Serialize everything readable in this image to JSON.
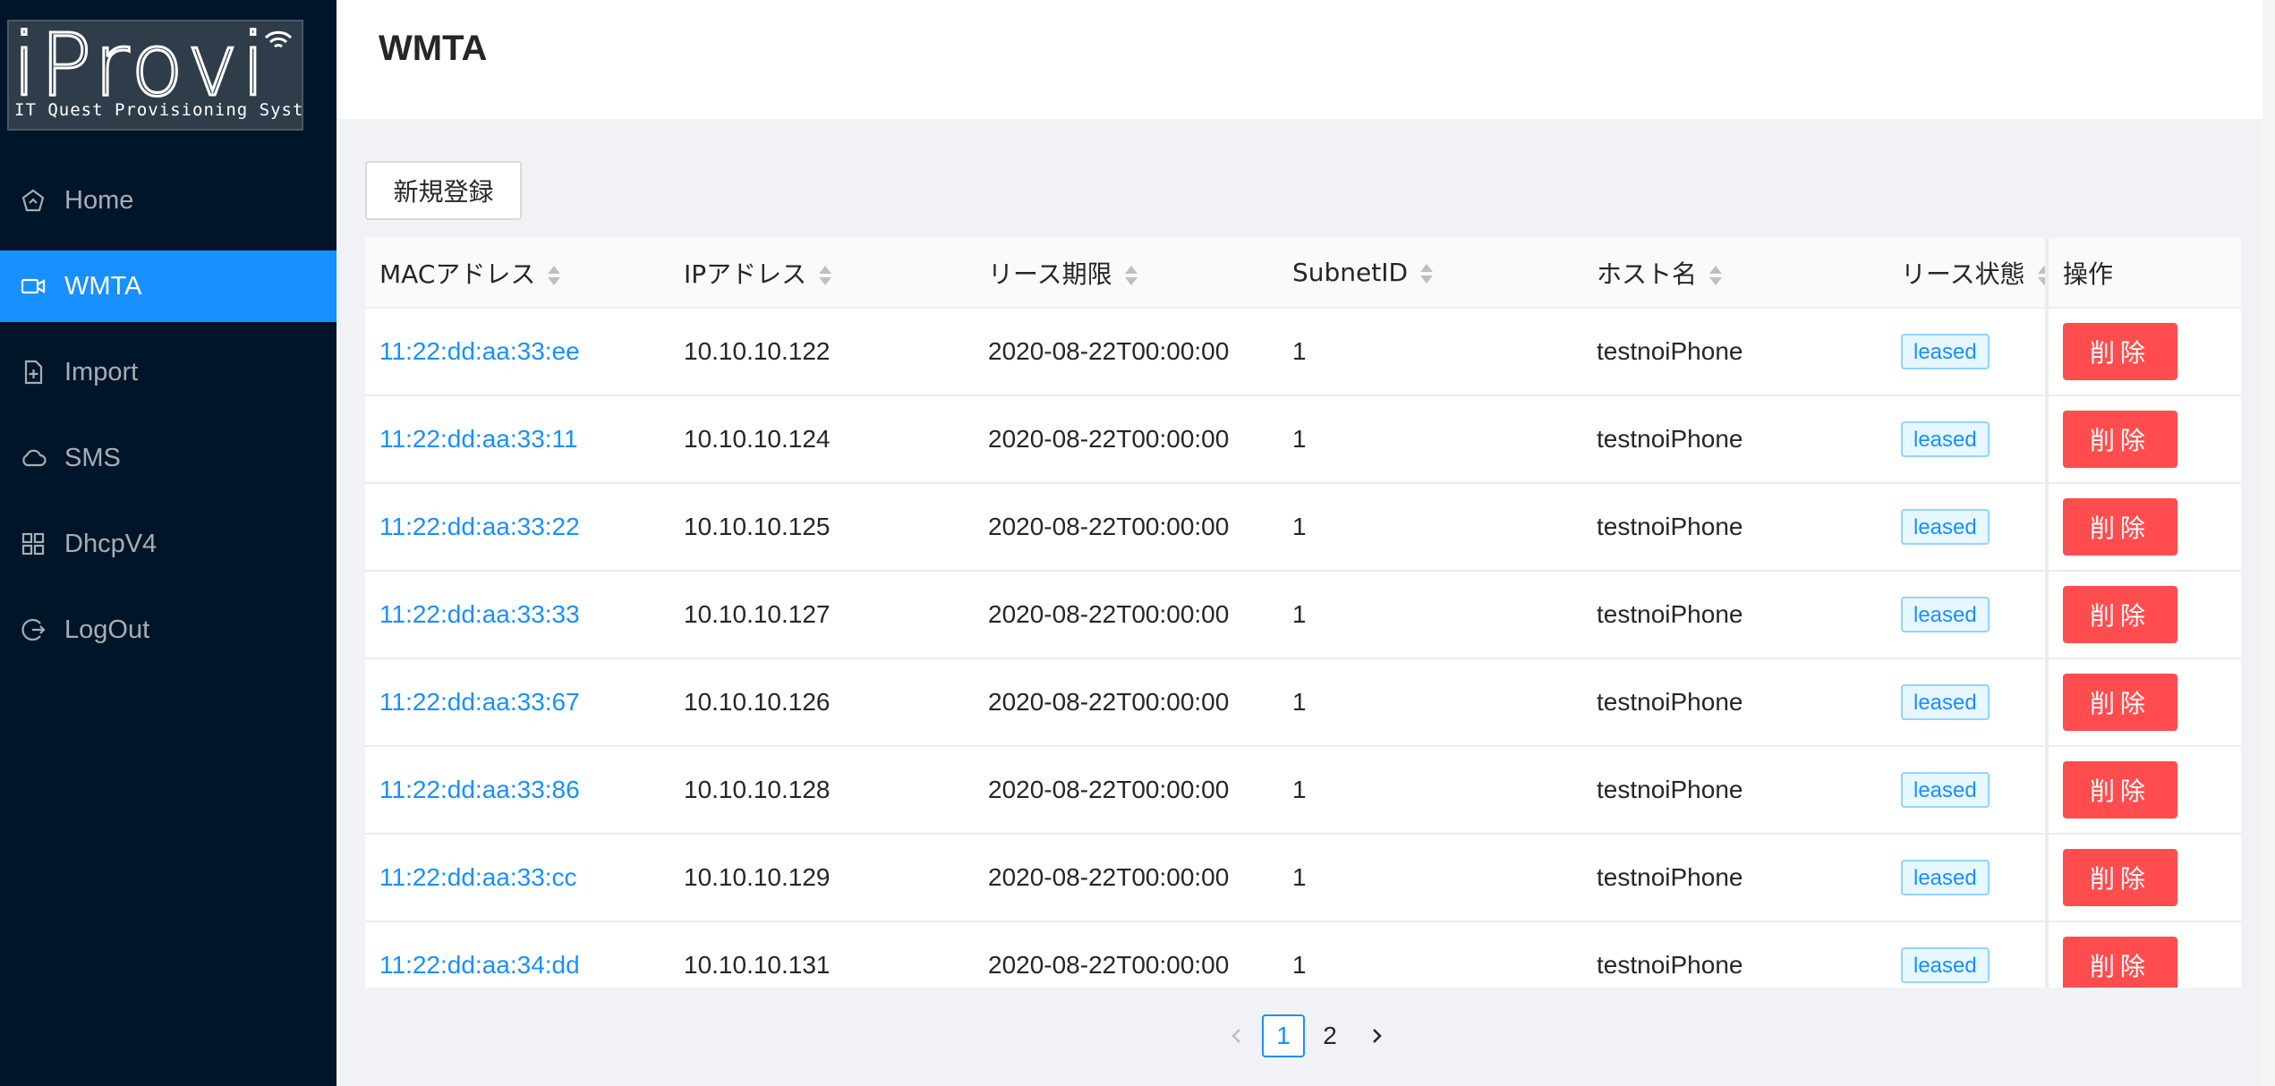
{
  "logo": {
    "word": "iProvi",
    "subtitle": "IT Quest Provisioning System"
  },
  "sidebar": {
    "items": [
      {
        "label": "Home",
        "icon": "home-icon"
      },
      {
        "label": "WMTA",
        "icon": "video-camera-icon",
        "active": true
      },
      {
        "label": "Import",
        "icon": "file-add-icon"
      },
      {
        "label": "SMS",
        "icon": "cloud-icon"
      },
      {
        "label": "DhcpV4",
        "icon": "appstore-icon"
      },
      {
        "label": "LogOut",
        "icon": "logout-icon"
      }
    ]
  },
  "header": {
    "title": "WMTA"
  },
  "toolbar": {
    "new_label": "新規登録"
  },
  "table": {
    "columns": [
      "MACアドレス",
      "IPアドレス",
      "リース期限",
      "SubnetID",
      "ホスト名",
      "リース状態",
      "操作"
    ],
    "delete_label": "削除",
    "rows": [
      {
        "mac": "11:22:dd:aa:33:ee",
        "ip": "10.10.10.122",
        "expiry": "2020-08-22T00:00:00",
        "subnet": "1",
        "host": "testnoiPhone",
        "state": "leased"
      },
      {
        "mac": "11:22:dd:aa:33:11",
        "ip": "10.10.10.124",
        "expiry": "2020-08-22T00:00:00",
        "subnet": "1",
        "host": "testnoiPhone",
        "state": "leased"
      },
      {
        "mac": "11:22:dd:aa:33:22",
        "ip": "10.10.10.125",
        "expiry": "2020-08-22T00:00:00",
        "subnet": "1",
        "host": "testnoiPhone",
        "state": "leased"
      },
      {
        "mac": "11:22:dd:aa:33:33",
        "ip": "10.10.10.127",
        "expiry": "2020-08-22T00:00:00",
        "subnet": "1",
        "host": "testnoiPhone",
        "state": "leased"
      },
      {
        "mac": "11:22:dd:aa:33:67",
        "ip": "10.10.10.126",
        "expiry": "2020-08-22T00:00:00",
        "subnet": "1",
        "host": "testnoiPhone",
        "state": "leased"
      },
      {
        "mac": "11:22:dd:aa:33:86",
        "ip": "10.10.10.128",
        "expiry": "2020-08-22T00:00:00",
        "subnet": "1",
        "host": "testnoiPhone",
        "state": "leased"
      },
      {
        "mac": "11:22:dd:aa:33:cc",
        "ip": "10.10.10.129",
        "expiry": "2020-08-22T00:00:00",
        "subnet": "1",
        "host": "testnoiPhone",
        "state": "leased"
      },
      {
        "mac": "11:22:dd:aa:34:dd",
        "ip": "10.10.10.131",
        "expiry": "2020-08-22T00:00:00",
        "subnet": "1",
        "host": "testnoiPhone",
        "state": "leased"
      }
    ]
  },
  "pagination": {
    "pages": [
      "1",
      "2"
    ],
    "current": "1"
  },
  "colors": {
    "sidebar_bg": "#001529",
    "accent": "#1890ff",
    "danger": "#ff4d4f",
    "content_bg": "#f0f2f5"
  }
}
